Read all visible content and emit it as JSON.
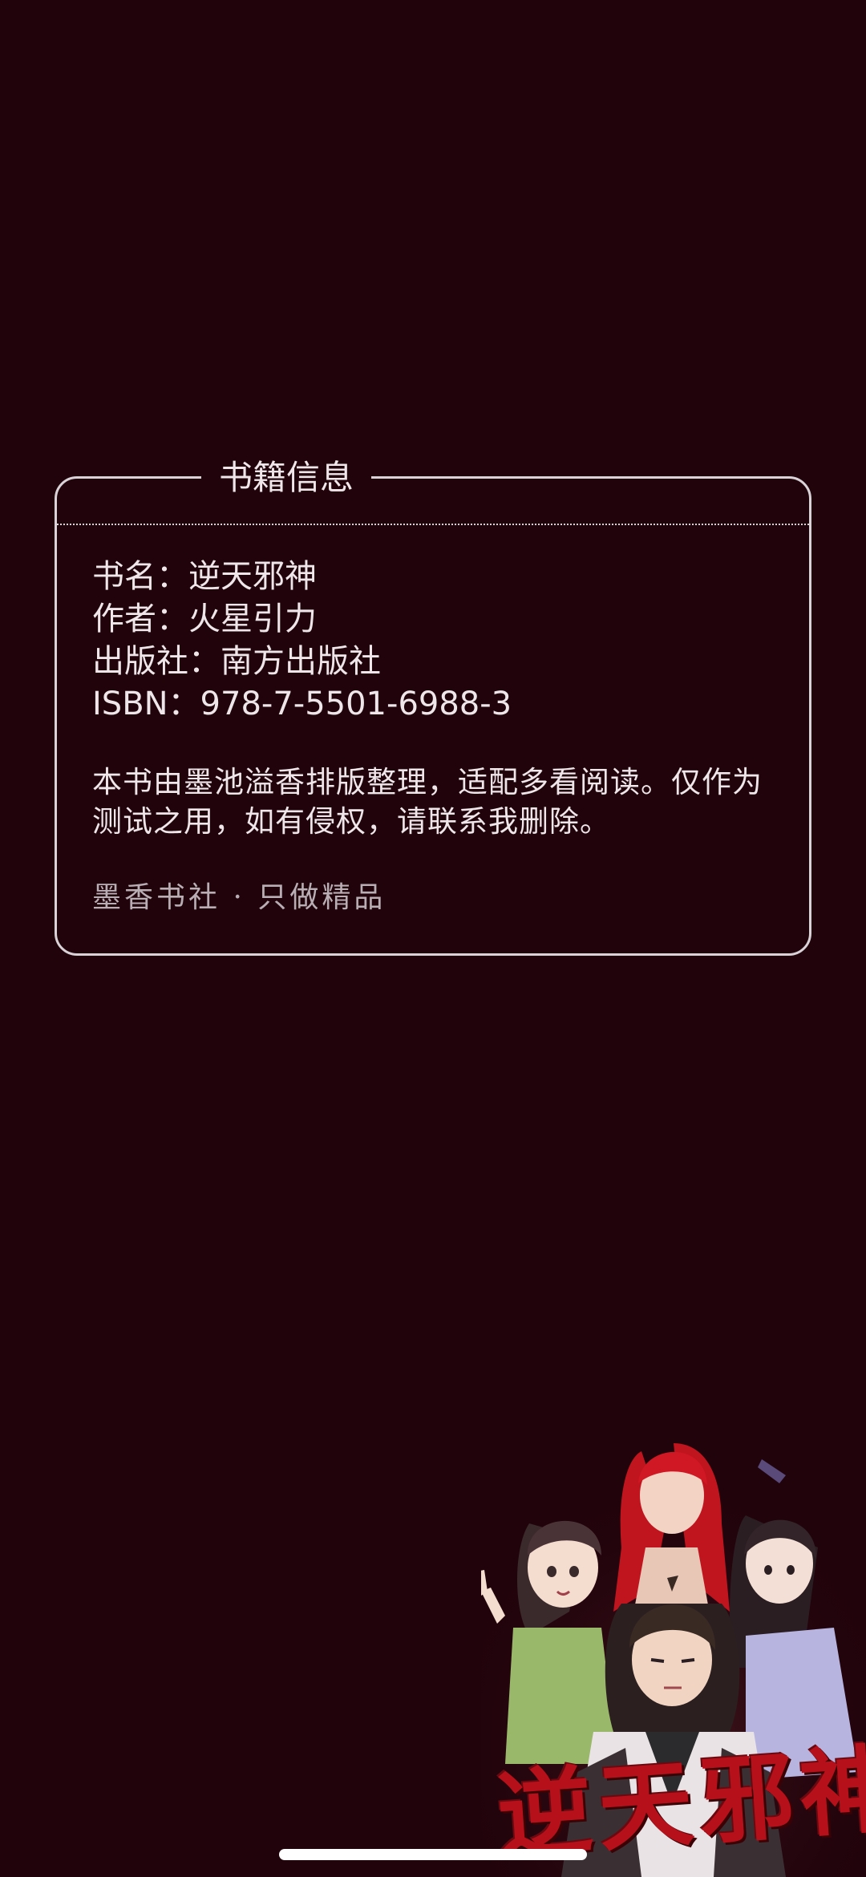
{
  "info_card": {
    "title": "书籍信息",
    "book_name": "书名：逆天邪神",
    "author": "作者：火星引力",
    "publisher": "出版社：南方出版社",
    "isbn": "ISBN：978-7-5501-6988-3",
    "note": "本书由墨池溢香排版整理，适配多看阅读。仅作为测试之用，如有侵权，请联系我删除。",
    "slogan": "墨香书社 · 只做精品"
  },
  "cover": {
    "title_art": "逆天邪神"
  },
  "colors": {
    "background": "#21030c",
    "border": "#d9d2d6",
    "text": "#efe6ea",
    "muted_text": "#b9aeb3",
    "cover_title": "#b6101a"
  }
}
